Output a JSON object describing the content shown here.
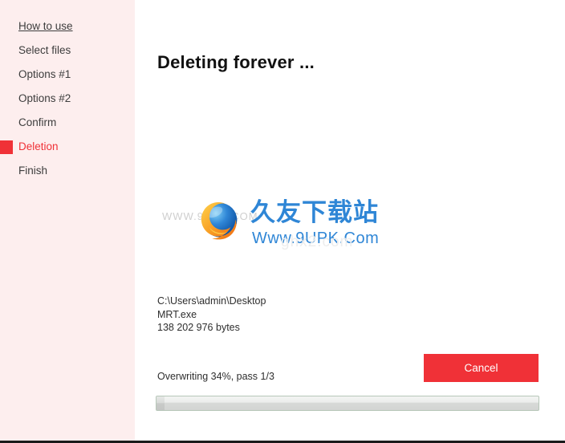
{
  "window": {
    "controls": [
      {
        "name": "more-options-button",
        "label": "···",
        "icon": "ellipsis-icon"
      },
      {
        "name": "minimize-button",
        "label": "—",
        "icon": "minimize-icon"
      },
      {
        "name": "close-button",
        "label": "✕",
        "icon": "close-icon"
      }
    ]
  },
  "sidebar": {
    "background_color": "#fdeeee",
    "active_color": "#f03137",
    "items": [
      {
        "label": "How to use",
        "active": false,
        "link": true
      },
      {
        "label": "Select files",
        "active": false,
        "link": false
      },
      {
        "label": "Options #1",
        "active": false,
        "link": false
      },
      {
        "label": "Options #2",
        "active": false,
        "link": false
      },
      {
        "label": "Confirm",
        "active": false,
        "link": false
      },
      {
        "label": "Deletion",
        "active": true,
        "link": false
      },
      {
        "label": "Finish",
        "active": false,
        "link": false
      }
    ]
  },
  "main": {
    "title": "Deleting forever ...",
    "file": {
      "path": "C:\\Users\\admin\\Desktop",
      "name": "MRT.exe",
      "size": "138 202 976 bytes"
    },
    "progress": {
      "status_text": "Overwriting 34%, pass 1/3",
      "percent": 34,
      "pass_current": 1,
      "pass_total": 3,
      "bar_fill_percent": 2
    },
    "cancel_label": "Cancel",
    "cancel_color": "#f03137"
  },
  "watermark": {
    "faint_text": "WWW.9UPK.COM",
    "brand_cn": "久友下载站",
    "brand_url": "Www.9UPK.Com",
    "ghost_text": "ghx2.com",
    "brand_color": "#2f86d6"
  }
}
